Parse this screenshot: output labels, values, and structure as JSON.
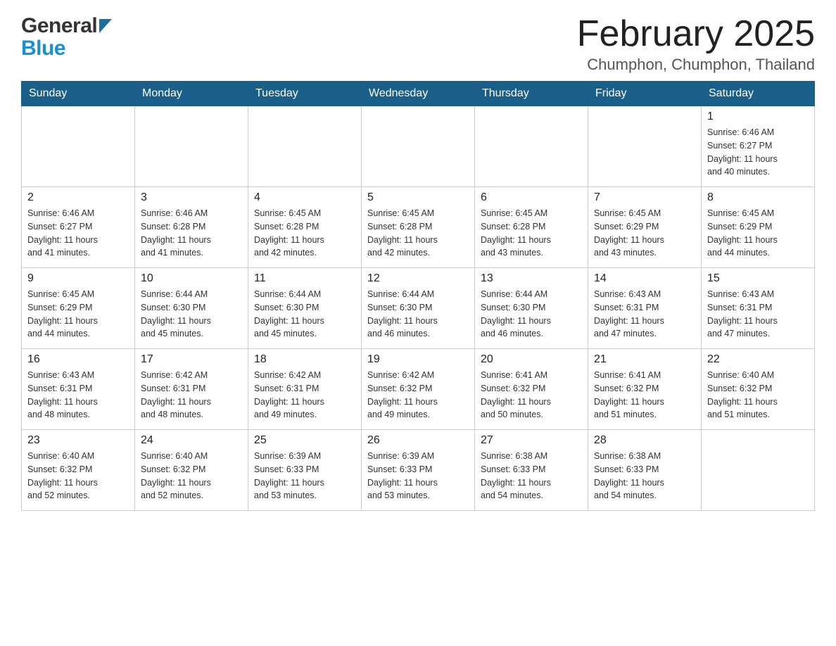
{
  "header": {
    "title": "February 2025",
    "location": "Chumphon, Chumphon, Thailand",
    "logo_general": "General",
    "logo_blue": "Blue"
  },
  "weekdays": [
    "Sunday",
    "Monday",
    "Tuesday",
    "Wednesday",
    "Thursday",
    "Friday",
    "Saturday"
  ],
  "weeks": [
    [
      {
        "day": "",
        "info": ""
      },
      {
        "day": "",
        "info": ""
      },
      {
        "day": "",
        "info": ""
      },
      {
        "day": "",
        "info": ""
      },
      {
        "day": "",
        "info": ""
      },
      {
        "day": "",
        "info": ""
      },
      {
        "day": "1",
        "info": "Sunrise: 6:46 AM\nSunset: 6:27 PM\nDaylight: 11 hours\nand 40 minutes."
      }
    ],
    [
      {
        "day": "2",
        "info": "Sunrise: 6:46 AM\nSunset: 6:27 PM\nDaylight: 11 hours\nand 41 minutes."
      },
      {
        "day": "3",
        "info": "Sunrise: 6:46 AM\nSunset: 6:28 PM\nDaylight: 11 hours\nand 41 minutes."
      },
      {
        "day": "4",
        "info": "Sunrise: 6:45 AM\nSunset: 6:28 PM\nDaylight: 11 hours\nand 42 minutes."
      },
      {
        "day": "5",
        "info": "Sunrise: 6:45 AM\nSunset: 6:28 PM\nDaylight: 11 hours\nand 42 minutes."
      },
      {
        "day": "6",
        "info": "Sunrise: 6:45 AM\nSunset: 6:28 PM\nDaylight: 11 hours\nand 43 minutes."
      },
      {
        "day": "7",
        "info": "Sunrise: 6:45 AM\nSunset: 6:29 PM\nDaylight: 11 hours\nand 43 minutes."
      },
      {
        "day": "8",
        "info": "Sunrise: 6:45 AM\nSunset: 6:29 PM\nDaylight: 11 hours\nand 44 minutes."
      }
    ],
    [
      {
        "day": "9",
        "info": "Sunrise: 6:45 AM\nSunset: 6:29 PM\nDaylight: 11 hours\nand 44 minutes."
      },
      {
        "day": "10",
        "info": "Sunrise: 6:44 AM\nSunset: 6:30 PM\nDaylight: 11 hours\nand 45 minutes."
      },
      {
        "day": "11",
        "info": "Sunrise: 6:44 AM\nSunset: 6:30 PM\nDaylight: 11 hours\nand 45 minutes."
      },
      {
        "day": "12",
        "info": "Sunrise: 6:44 AM\nSunset: 6:30 PM\nDaylight: 11 hours\nand 46 minutes."
      },
      {
        "day": "13",
        "info": "Sunrise: 6:44 AM\nSunset: 6:30 PM\nDaylight: 11 hours\nand 46 minutes."
      },
      {
        "day": "14",
        "info": "Sunrise: 6:43 AM\nSunset: 6:31 PM\nDaylight: 11 hours\nand 47 minutes."
      },
      {
        "day": "15",
        "info": "Sunrise: 6:43 AM\nSunset: 6:31 PM\nDaylight: 11 hours\nand 47 minutes."
      }
    ],
    [
      {
        "day": "16",
        "info": "Sunrise: 6:43 AM\nSunset: 6:31 PM\nDaylight: 11 hours\nand 48 minutes."
      },
      {
        "day": "17",
        "info": "Sunrise: 6:42 AM\nSunset: 6:31 PM\nDaylight: 11 hours\nand 48 minutes."
      },
      {
        "day": "18",
        "info": "Sunrise: 6:42 AM\nSunset: 6:31 PM\nDaylight: 11 hours\nand 49 minutes."
      },
      {
        "day": "19",
        "info": "Sunrise: 6:42 AM\nSunset: 6:32 PM\nDaylight: 11 hours\nand 49 minutes."
      },
      {
        "day": "20",
        "info": "Sunrise: 6:41 AM\nSunset: 6:32 PM\nDaylight: 11 hours\nand 50 minutes."
      },
      {
        "day": "21",
        "info": "Sunrise: 6:41 AM\nSunset: 6:32 PM\nDaylight: 11 hours\nand 51 minutes."
      },
      {
        "day": "22",
        "info": "Sunrise: 6:40 AM\nSunset: 6:32 PM\nDaylight: 11 hours\nand 51 minutes."
      }
    ],
    [
      {
        "day": "23",
        "info": "Sunrise: 6:40 AM\nSunset: 6:32 PM\nDaylight: 11 hours\nand 52 minutes."
      },
      {
        "day": "24",
        "info": "Sunrise: 6:40 AM\nSunset: 6:32 PM\nDaylight: 11 hours\nand 52 minutes."
      },
      {
        "day": "25",
        "info": "Sunrise: 6:39 AM\nSunset: 6:33 PM\nDaylight: 11 hours\nand 53 minutes."
      },
      {
        "day": "26",
        "info": "Sunrise: 6:39 AM\nSunset: 6:33 PM\nDaylight: 11 hours\nand 53 minutes."
      },
      {
        "day": "27",
        "info": "Sunrise: 6:38 AM\nSunset: 6:33 PM\nDaylight: 11 hours\nand 54 minutes."
      },
      {
        "day": "28",
        "info": "Sunrise: 6:38 AM\nSunset: 6:33 PM\nDaylight: 11 hours\nand 54 minutes."
      },
      {
        "day": "",
        "info": ""
      }
    ]
  ]
}
